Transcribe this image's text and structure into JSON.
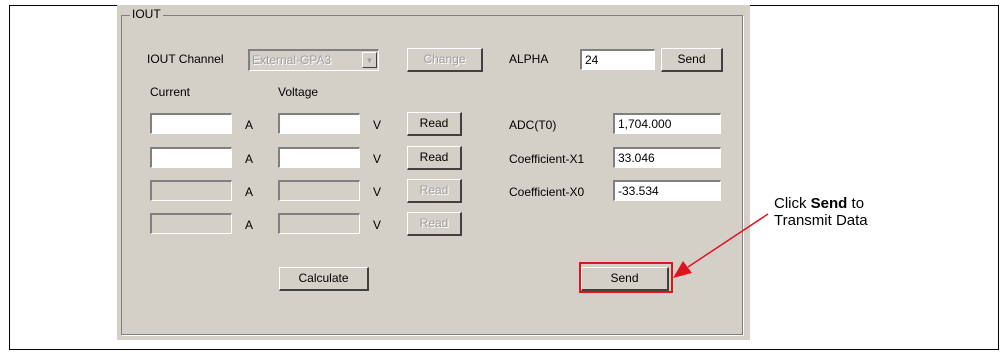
{
  "group_title": "IOUT",
  "channel": {
    "label": "IOUT Channel",
    "value": "External-GPA3",
    "change_label": "Change"
  },
  "alpha": {
    "label": "ALPHA",
    "value": "24",
    "send_label": "Send"
  },
  "headers": {
    "current": "Current",
    "voltage": "Voltage"
  },
  "units": {
    "amp": "A",
    "volt": "V"
  },
  "read_label": "Read",
  "rows": [
    {
      "current": "",
      "voltage": "",
      "enabled": true
    },
    {
      "current": "",
      "voltage": "",
      "enabled": true
    },
    {
      "current": "",
      "voltage": "",
      "enabled": false
    },
    {
      "current": "",
      "voltage": "",
      "enabled": false
    }
  ],
  "coefficients": [
    {
      "label": "ADC(T0)",
      "value": "1,704.000"
    },
    {
      "label": "Coefficient-X1",
      "value": "33.046"
    },
    {
      "label": "Coefficient-X0",
      "value": "-33.534"
    }
  ],
  "calculate_label": "Calculate",
  "send_label": "Send",
  "callout": {
    "prefix": "Click ",
    "bold": "Send",
    "suffix": " to",
    "line2": "Transmit Data"
  },
  "colors": {
    "panel": "#d4d0c8",
    "highlight": "#e0141e"
  }
}
